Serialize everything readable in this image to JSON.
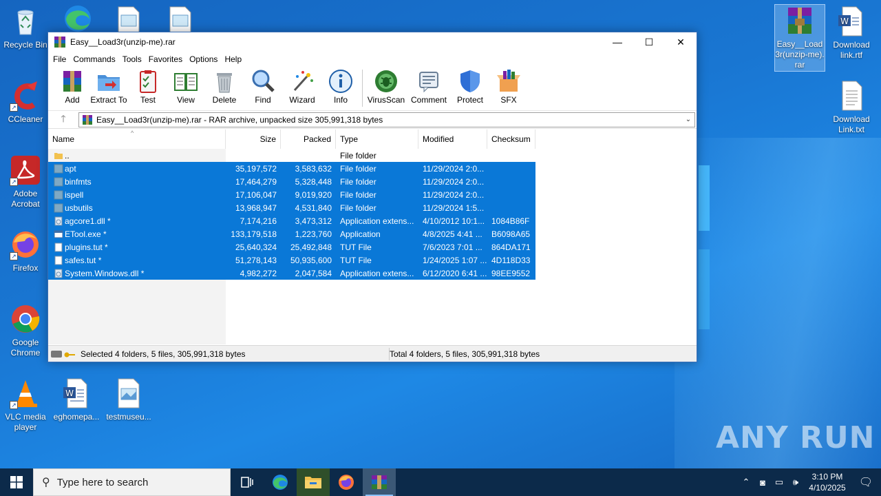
{
  "desktop": {
    "icons": [
      {
        "label": "Recycle Bin"
      },
      {
        "label": "CCleaner"
      },
      {
        "label": "Adobe Acrobat"
      },
      {
        "label": "Firefox"
      },
      {
        "label": "Google Chrome"
      },
      {
        "label": "VLC media player"
      },
      {
        "label": "eghomepa..."
      },
      {
        "label": "testmuseu..."
      },
      {
        "label": "Easy__Load3r(unzip-me).rar"
      },
      {
        "label": "Download link.rtf"
      },
      {
        "label": "Download Link.txt"
      }
    ],
    "watermark": "ANY RUN"
  },
  "window": {
    "title": "Easy__Load3r(unzip-me).rar",
    "menu": [
      "File",
      "Commands",
      "Tools",
      "Favorites",
      "Options",
      "Help"
    ],
    "toolbar": [
      "Add",
      "Extract To",
      "Test",
      "View",
      "Delete",
      "Find",
      "Wizard",
      "Info",
      "VirusScan",
      "Comment",
      "Protect",
      "SFX"
    ],
    "address": "Easy__Load3r(unzip-me).rar - RAR archive, unpacked size 305,991,318 bytes",
    "columns": [
      "Name",
      "Size",
      "Packed",
      "Type",
      "Modified",
      "Checksum"
    ],
    "rows": [
      {
        "name": "..",
        "size": "",
        "packed": "",
        "type": "File folder",
        "modified": "",
        "checksum": "",
        "selected": false,
        "kind": "folder-up"
      },
      {
        "name": "apt",
        "size": "35,197,572",
        "packed": "3,583,632",
        "type": "File folder",
        "modified": "11/29/2024 2:0...",
        "checksum": "",
        "selected": true,
        "kind": "folder"
      },
      {
        "name": "binfmts",
        "size": "17,464,279",
        "packed": "5,328,448",
        "type": "File folder",
        "modified": "11/29/2024 2:0...",
        "checksum": "",
        "selected": true,
        "kind": "folder"
      },
      {
        "name": "ispell",
        "size": "17,106,047",
        "packed": "9,019,920",
        "type": "File folder",
        "modified": "11/29/2024 2:0...",
        "checksum": "",
        "selected": true,
        "kind": "folder"
      },
      {
        "name": "usbutils",
        "size": "13,968,947",
        "packed": "4,531,840",
        "type": "File folder",
        "modified": "11/29/2024 1:5...",
        "checksum": "",
        "selected": true,
        "kind": "folder"
      },
      {
        "name": "agcore1.dll *",
        "size": "7,174,216",
        "packed": "3,473,312",
        "type": "Application extens...",
        "modified": "4/10/2012 10:1...",
        "checksum": "1084B86F",
        "selected": true,
        "kind": "dll"
      },
      {
        "name": "ETool.exe *",
        "size": "133,179,518",
        "packed": "1,223,760",
        "type": "Application",
        "modified": "4/8/2025 4:41 ...",
        "checksum": "B6098A65",
        "selected": true,
        "kind": "exe"
      },
      {
        "name": "plugins.tut *",
        "size": "25,640,324",
        "packed": "25,492,848",
        "type": "TUT File",
        "modified": "7/6/2023 7:01 ...",
        "checksum": "864DA171",
        "selected": true,
        "kind": "file"
      },
      {
        "name": "safes.tut *",
        "size": "51,278,143",
        "packed": "50,935,600",
        "type": "TUT File",
        "modified": "1/24/2025 1:07 ...",
        "checksum": "4D118D33",
        "selected": true,
        "kind": "file"
      },
      {
        "name": "System.Windows.dll *",
        "size": "4,982,272",
        "packed": "2,047,584",
        "type": "Application extens...",
        "modified": "6/12/2020 6:41 ...",
        "checksum": "98EE9552",
        "selected": true,
        "kind": "dll"
      }
    ],
    "status_left": "Selected 4 folders, 5 files, 305,991,318 bytes",
    "status_right": "Total 4 folders, 5 files, 305,991,318 bytes"
  },
  "taskbar": {
    "search_placeholder": "Type here to search",
    "time": "3:10 PM",
    "date": "4/10/2025"
  },
  "colors": {
    "selection": "#0a78d7",
    "desktop": "#1976d2",
    "taskbar": "#0c2a4a"
  }
}
